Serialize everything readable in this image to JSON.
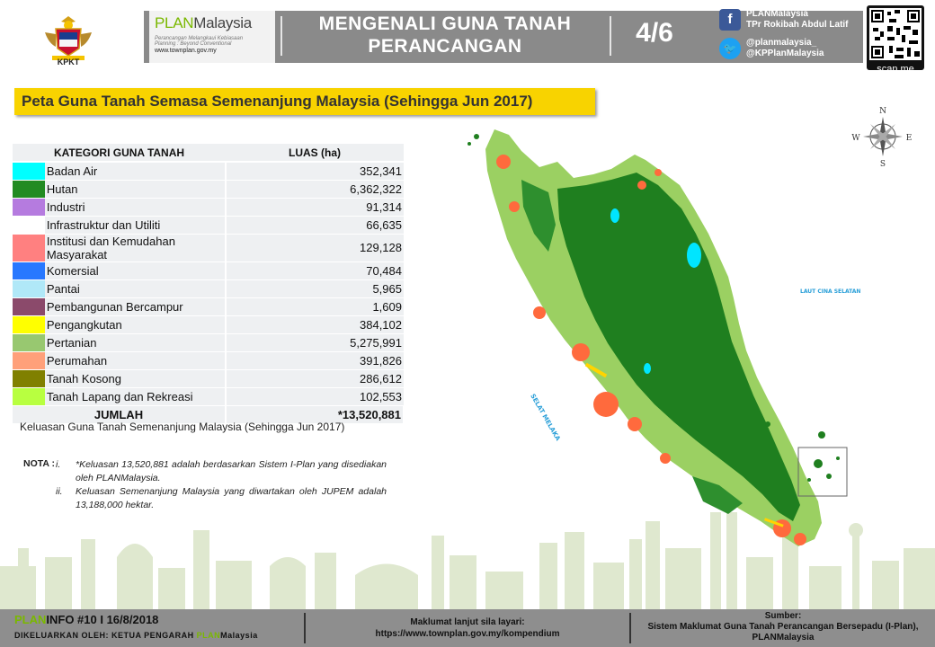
{
  "header": {
    "logo_label": "KPKT",
    "plan_name_prefix": "PLAN",
    "plan_name_suffix": "Malaysia",
    "plan_tagline_1": "Perancangan Melangkaui Kebiasaan",
    "plan_tagline_2": "Planning : Beyond Conventional",
    "plan_url": "www.townplan.gov.my",
    "title_line_1": "MENGENALI GUNA TANAH",
    "title_line_2": "PERANCANGAN",
    "page_number": "4/6",
    "facebook_line_1": "PLANMalaysia",
    "facebook_line_2": "TPr Rokibah Abdul Latif",
    "twitter_line_1": "@planmalaysia_",
    "twitter_line_2": "@KPPlanMalaysia",
    "qr_label": "scan me",
    "colors": {
      "band": "#8a8a8a",
      "brand_green": "#7ab800",
      "facebook": "#3b5998",
      "twitter": "#1da1f2"
    }
  },
  "subtitle": "Peta Guna Tanah Semasa Semenanjung Malaysia (Sehingga Jun 2017)",
  "table": {
    "header_category": "KATEGORI GUNA TANAH",
    "header_area": "LUAS (ha)",
    "rows": [
      {
        "color": "#00ffff",
        "category": "Badan Air",
        "area": "352,341"
      },
      {
        "color": "#228b22",
        "category": "Hutan",
        "area": "6,362,322"
      },
      {
        "color": "#b57bdf",
        "category": "Industri",
        "area": "91,314"
      },
      {
        "color": "#ffffff",
        "category": "Infrastruktur dan Utiliti",
        "area": "66,635"
      },
      {
        "color": "#ff8080",
        "category": "Institusi dan Kemudahan Masyarakat",
        "area": "129,128"
      },
      {
        "color": "#2878ff",
        "category": "Komersial",
        "area": "70,484"
      },
      {
        "color": "#b0e8f8",
        "category": "Pantai",
        "area": "5,965"
      },
      {
        "color": "#8b4a6b",
        "category": "Pembangunan Bercampur",
        "area": "1,609"
      },
      {
        "color": "#ffff00",
        "category": "Pengangkutan",
        "area": "384,102"
      },
      {
        "color": "#98c870",
        "category": "Pertanian",
        "area": "5,275,991"
      },
      {
        "color": "#ffa07a",
        "category": "Perumahan",
        "area": "391,826"
      },
      {
        "color": "#808000",
        "category": "Tanah Kosong",
        "area": "286,612"
      },
      {
        "color": "#b8ff40",
        "category": "Tanah Lapang dan Rekreasi",
        "area": "102,553"
      }
    ],
    "total_label": "JUMLAH",
    "total_value": "*13,520,881"
  },
  "caption": "Keluasan Guna Tanah Semenanjung Malaysia (Sehingga Jun 2017)",
  "notes": {
    "label": "NOTA :",
    "items": [
      {
        "num": "i.",
        "text": "*Keluasan 13,520,881 adalah berdasarkan Sistem I-Plan yang disediakan oleh PLANMalaysia."
      },
      {
        "num": "ii.",
        "text": "Keluasan Semenanjung Malaysia yang diwartakan oleh JUPEM adalah 13,188,000 hektar."
      }
    ]
  },
  "map": {
    "sea_east": "LAUT CINA SELATAN",
    "sea_west": "SELAT MELAKA",
    "compass": {
      "n": "N",
      "s": "S",
      "e": "E",
      "w": "W"
    }
  },
  "footer": {
    "issue_prefix": "PLAN",
    "issue_rest": "INFO #10 I 16/8/2018",
    "issued_by_prefix": "DIKELUARKAN OLEH: KETUA PENGARAH ",
    "issued_by_plan": "PLAN",
    "issued_by_suffix": "Malaysia",
    "more_info_label": "Maklumat lanjut sila layari:",
    "more_info_url": "https://www.townplan.gov.my/kompendium",
    "source_label": "Sumber:",
    "source_text_1": "Sistem Maklumat Guna Tanah Perancangan Bersepadu (I-Plan),",
    "source_text_2": "PLANMalaysia"
  }
}
